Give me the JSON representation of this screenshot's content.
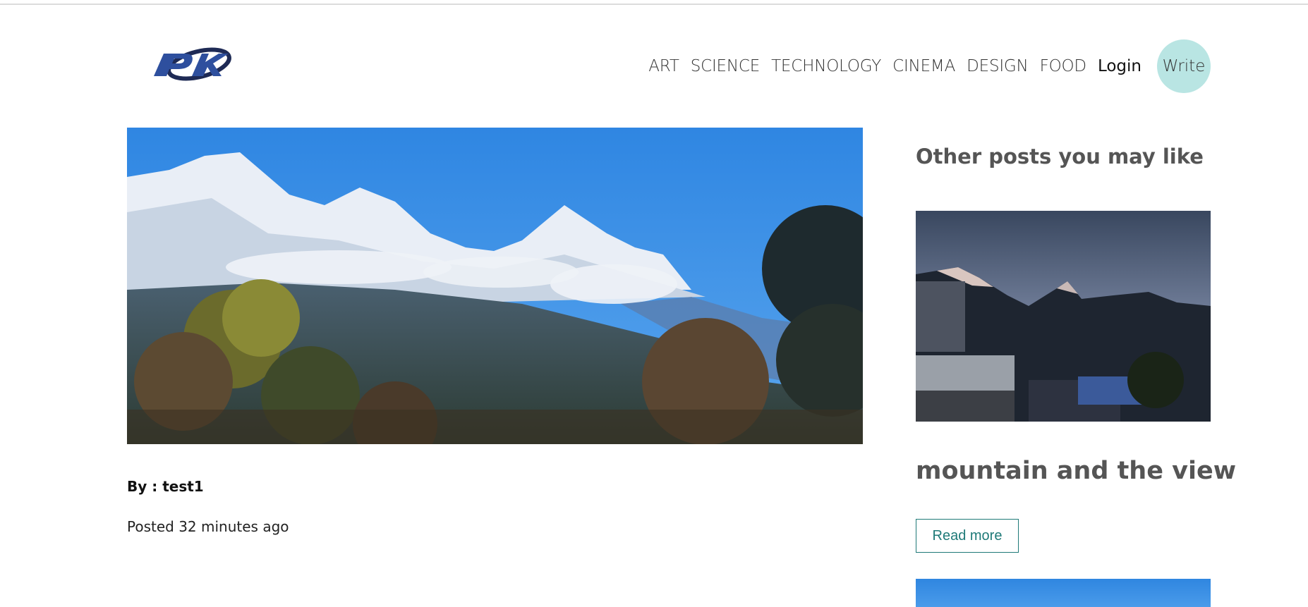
{
  "header": {
    "logo_text": "PK",
    "nav_items": [
      "ART",
      "SCIENCE",
      "TECHNOLOGY",
      "CINEMA",
      "DESIGN",
      "FOOD"
    ],
    "login_label": "Login",
    "write_label": "Write"
  },
  "post": {
    "image_icon": "mountain-landscape-image",
    "author_line": "By : test1",
    "posted_line": "Posted 32 minutes ago"
  },
  "sidebar": {
    "heading": "Other posts you may like",
    "posts": [
      {
        "image_icon": "dusk-mountain-village-image",
        "title": "mountain and the view",
        "read_more_label": "Read more"
      }
    ]
  },
  "colors": {
    "accent_teal": "#1f7a78",
    "write_bubble": "#b9e5e3",
    "sky_blue": "#3a8fe6"
  }
}
